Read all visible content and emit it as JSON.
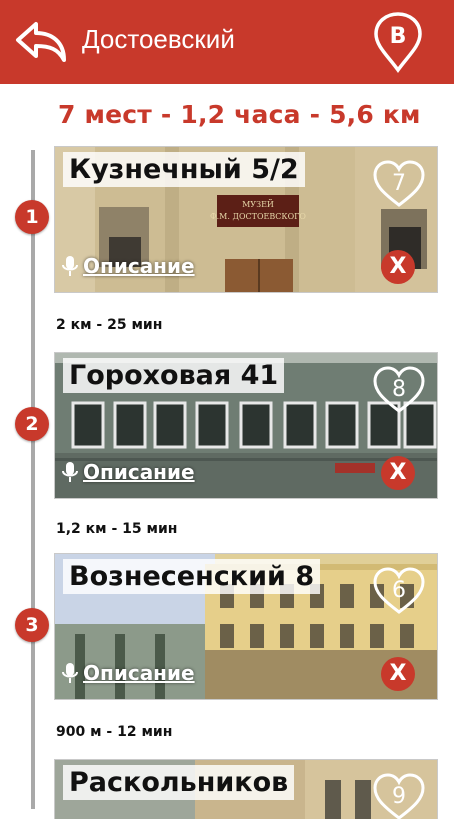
{
  "header": {
    "title": "Достоевский",
    "back_icon": "back-arrow-icon",
    "pin_icon": "map-pin-b-icon",
    "pin_letter": "B",
    "background": "#c8392b"
  },
  "summary": "7 мест - 1,2 часа - 5,6 км",
  "places": [
    {
      "step": "1",
      "title": "Кузнечный 5/2",
      "likes": "7",
      "desc_label": "Описание",
      "remove_label": "X",
      "sign_line1": "МУЗЕЙ",
      "sign_line2": "Ф.М. ДОСТОЕВСКОГО"
    },
    {
      "step": "2",
      "title": "Гороховая 41",
      "likes": "8",
      "desc_label": "Описание",
      "remove_label": "X"
    },
    {
      "step": "3",
      "title": "Вознесенский 8",
      "likes": "6",
      "desc_label": "Описание",
      "remove_label": "X"
    },
    {
      "step": "",
      "title": "Раскольников",
      "likes": "9",
      "desc_label": "",
      "remove_label": ""
    }
  ],
  "distances": [
    "2 км - 25 мин",
    "1,2 км - 15 мин",
    "900 м - 12 мин"
  ],
  "colors": {
    "accent": "#c8392b",
    "timeline": "#a9a9a9"
  }
}
